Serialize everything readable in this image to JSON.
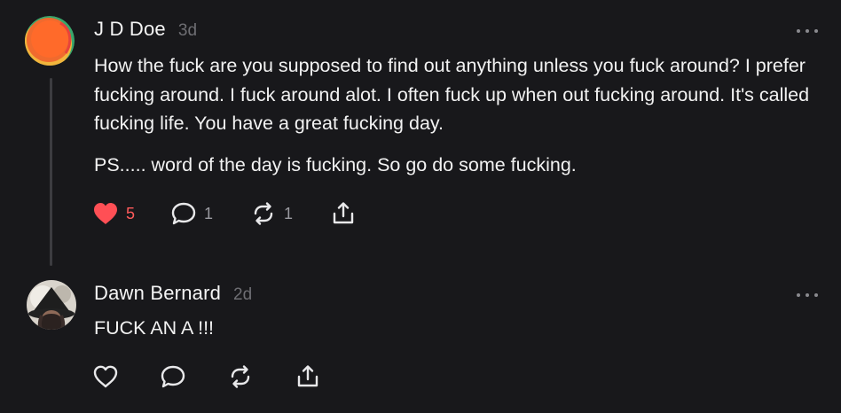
{
  "posts": [
    {
      "author": "J D Doe",
      "time": "3d",
      "paragraphs": [
        "How the fuck are you supposed to find out anything unless you fuck around? I prefer fucking around. I fuck around alot. I often fuck up when out fucking around. It's called fucking life. You have a great fucking day.",
        "PS..... word of the day is fucking. So go do some fucking."
      ],
      "likes": "5",
      "replies": "1",
      "reposts": "1",
      "liked": true,
      "avatar_colors": [
        "#ff6b2c",
        "#3aa66b",
        "#f2b53c",
        "#e8433b"
      ]
    },
    {
      "author": "Dawn Bernard",
      "time": "2d",
      "paragraphs": [
        "FUCK AN A !!!"
      ],
      "likes": "",
      "replies": "",
      "reposts": "",
      "liked": false
    }
  ],
  "icons": {
    "like": "heart-icon",
    "reply": "speech-bubble-icon",
    "repost": "repost-icon",
    "share": "share-icon",
    "more": "more-dots-icon"
  },
  "colors": {
    "background": "#18181b",
    "like_active": "#ff4f55",
    "muted": "#9a9aa0"
  }
}
